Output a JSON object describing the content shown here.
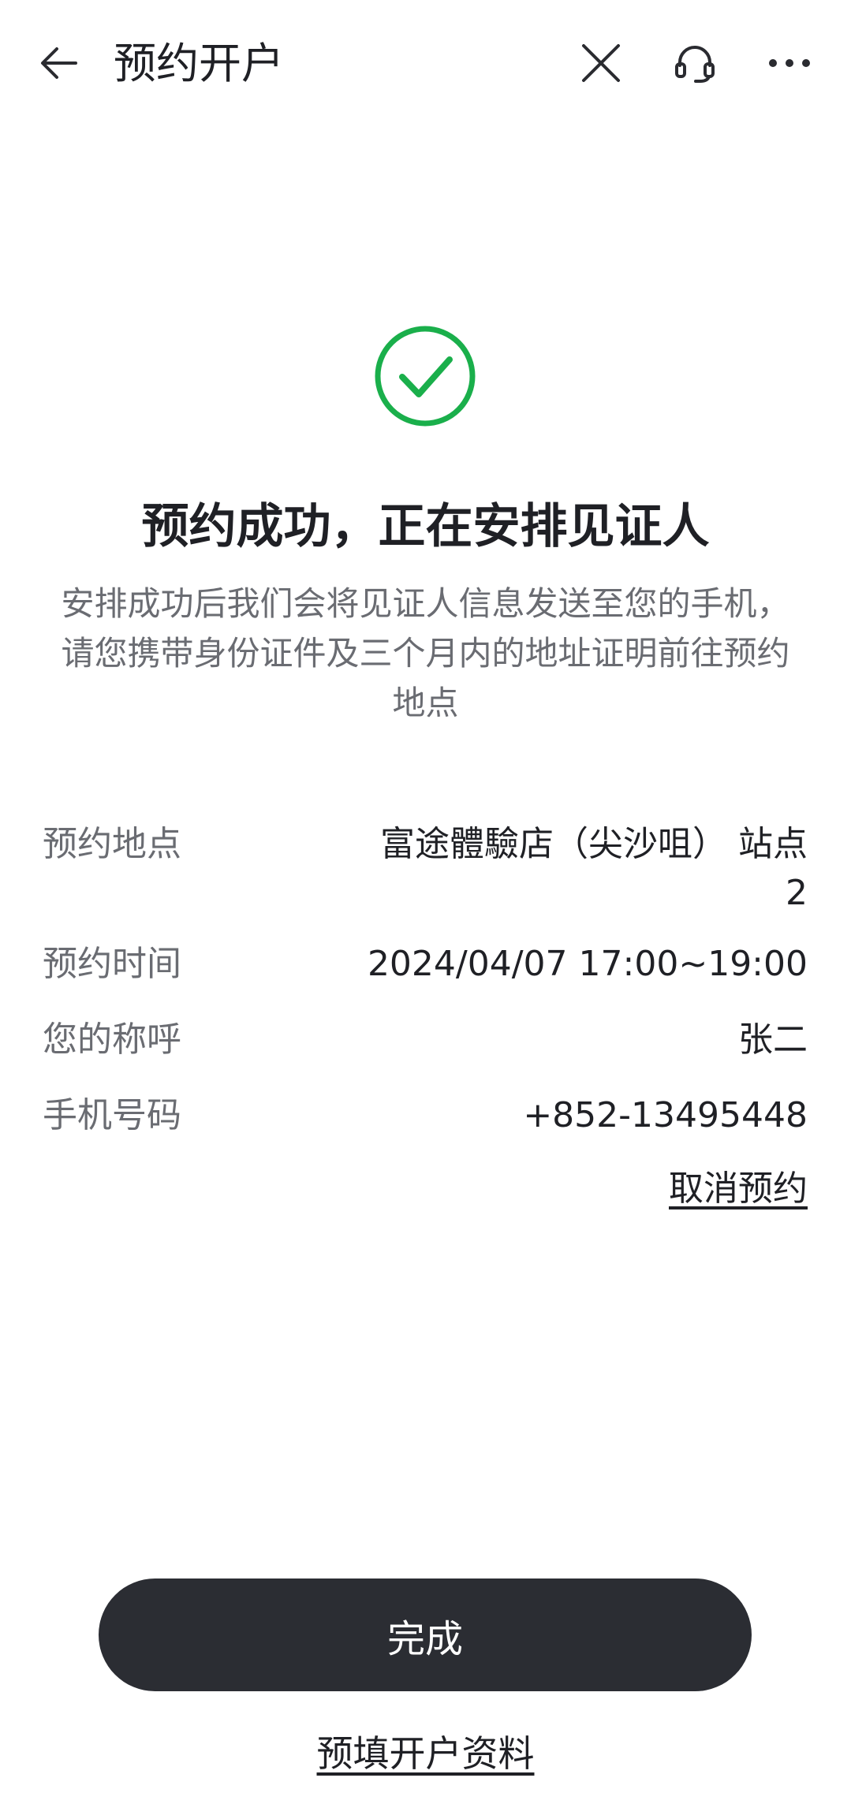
{
  "header": {
    "title": "预约开户",
    "icons": {
      "back": "arrow-left-icon",
      "close": "close-icon",
      "support": "headset-icon",
      "more": "more-dots-icon"
    }
  },
  "status": {
    "icon": "check-circle-icon",
    "title": "预约成功，正在安排见证人",
    "description": "安排成功后我们会将见证人信息发送至您的手机，请您携带身份证件及三个月内的地址证明前往预约地点"
  },
  "details": [
    {
      "label": "预约地点",
      "value": "富途體驗店（尖沙咀） 站点2"
    },
    {
      "label": "预约时间",
      "value": "2024/04/07 17:00~19:00"
    },
    {
      "label": "您的称呼",
      "value": "张二"
    },
    {
      "label": "手机号码",
      "value": "+852-13495448"
    }
  ],
  "actions": {
    "cancel_label": "取消预约",
    "done_label": "完成",
    "prefill_label": "预填开户资料"
  },
  "colors": {
    "success_green": "#1aaf4b",
    "button_dark": "#2b2d33",
    "text_primary": "#1f2025",
    "text_secondary": "#6a6c72"
  }
}
